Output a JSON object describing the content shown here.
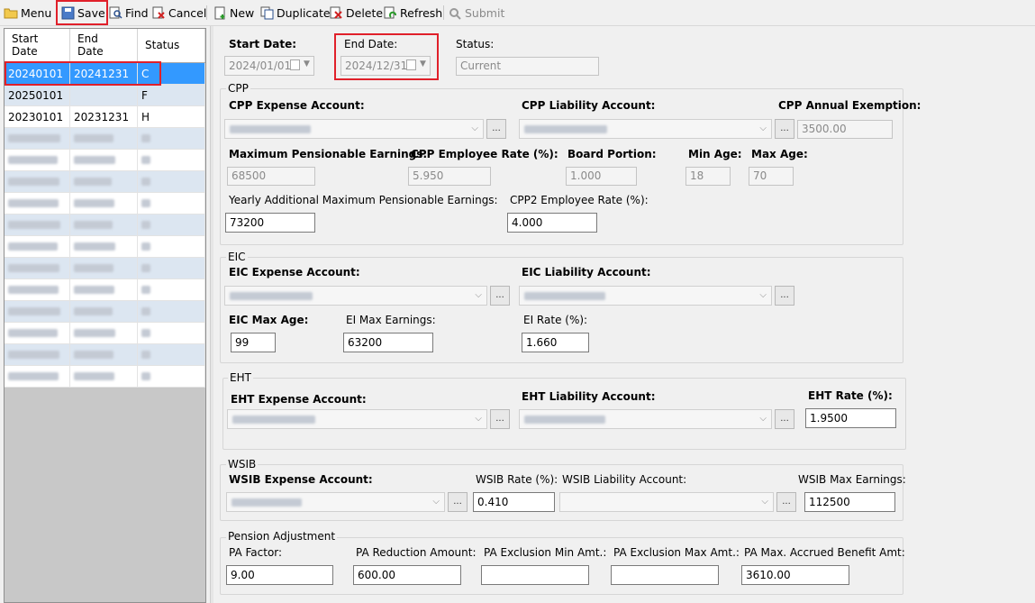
{
  "toolbar": {
    "menu": "Menu",
    "save": "Save",
    "find": "Find",
    "cancel": "Cancel",
    "new": "New",
    "duplicate": "Duplicate",
    "delete": "Delete",
    "refresh": "Refresh",
    "submit": "Submit"
  },
  "grid": {
    "headers": [
      "Start\nDate",
      "End\nDate",
      "Status"
    ],
    "header_start": "Start",
    "header_start2": "Date",
    "header_end": "End",
    "header_end2": "Date",
    "header_status": "Status",
    "rows": [
      {
        "start": "20240101",
        "end": "20241231",
        "status": "C"
      },
      {
        "start": "20250101",
        "end": "",
        "status": "F"
      },
      {
        "start": "20230101",
        "end": "20231231",
        "status": "H"
      }
    ]
  },
  "header": {
    "start_date_label": "Start Date:",
    "start_date_value": "2024/01/01",
    "end_date_label": "End Date:",
    "end_date_value": "2024/12/31",
    "status_label": "Status:",
    "status_value": "Current"
  },
  "cpp": {
    "title": "CPP",
    "expense_label": "CPP Expense Account:",
    "liability_label": "CPP Liability Account:",
    "exemption_label": "CPP Annual Exemption:",
    "exemption_value": "3500.00",
    "mpe_label": "Maximum Pensionable Earnings:",
    "mpe_value": "68500",
    "rate_label": "CPP Employee Rate (%):",
    "rate_value": "5.950",
    "board_label": "Board Portion:",
    "board_value": "1.000",
    "min_age_label": "Min Age:",
    "min_age_value": "18",
    "max_age_label": "Max Age:",
    "max_age_value": "70",
    "yampe_label": "Yearly Additional Maximum Pensionable Earnings:",
    "yampe_value": "73200",
    "cpp2_label": "CPP2 Employee Rate (%):",
    "cpp2_value": "4.000"
  },
  "eic": {
    "title": "EIC",
    "expense_label": "EIC Expense Account:",
    "liability_label": "EIC Liability Account:",
    "max_age_label": "EIC Max Age:",
    "max_age_value": "99",
    "max_earn_label": "EI Max Earnings:",
    "max_earn_value": "63200",
    "rate_label": "EI Rate (%):",
    "rate_value": "1.660"
  },
  "eht": {
    "title": "EHT",
    "expense_label": "EHT Expense Account:",
    "liability_label": "EHT Liability Account:",
    "rate_label": "EHT Rate (%):",
    "rate_value": "1.9500"
  },
  "wsib": {
    "title": "WSIB",
    "expense_label": "WSIB Expense Account:",
    "rate_label": "WSIB Rate (%):",
    "rate_value": "0.410",
    "liability_label": "WSIB Liability Account:",
    "max_earn_label": "WSIB Max Earnings:",
    "max_earn_value": "112500"
  },
  "pension": {
    "title": "Pension Adjustment",
    "factor_label": "PA Factor:",
    "factor_value": "9.00",
    "reduction_label": "PA Reduction Amount:",
    "reduction_value": "600.00",
    "excl_min_label": "PA Exclusion Min Amt.:",
    "excl_min_value": "",
    "excl_max_label": "PA Exclusion Max Amt.:",
    "excl_max_value": "",
    "accrued_label": "PA Max. Accrued Benefit Amt:",
    "accrued_value": "3610.00"
  },
  "colors": {
    "highlight": "#e0202a",
    "selected_row": "#3399ff",
    "alt_row": "#dce6f1"
  },
  "icons": [
    "folder-icon",
    "save-icon",
    "find-icon",
    "cancel-icon",
    "new-icon",
    "duplicate-icon",
    "delete-icon",
    "refresh-icon",
    "submit-icon",
    "calendar-icon",
    "chevron-down-icon"
  ]
}
